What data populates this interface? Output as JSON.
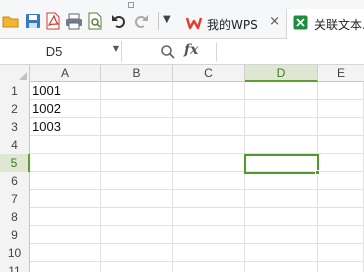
{
  "toolbar": {
    "tabs": [
      {
        "label": "我的WPS",
        "icon": "wps-logo-icon"
      },
      {
        "label": "关联文本.x",
        "icon": "excel-file-icon"
      }
    ],
    "tab_close_glyph": "×",
    "dropdown_glyph": "▼"
  },
  "formula_bar": {
    "name_box_value": "D5",
    "fx_label": "fx"
  },
  "sheet": {
    "columns": [
      "A",
      "B",
      "C",
      "D",
      "E"
    ],
    "rows": [
      "1",
      "2",
      "3",
      "4",
      "5",
      "6",
      "7",
      "8",
      "9",
      "10",
      "11"
    ],
    "cells": {
      "A1": "1001",
      "A2": "1002",
      "A3": "1003"
    },
    "active_cell": "D5",
    "active_column": "D",
    "active_row": "5"
  },
  "colors": {
    "accent_green": "#4e9a2b",
    "wps_red": "#e23b2e",
    "excel_green": "#1e8e3e"
  }
}
